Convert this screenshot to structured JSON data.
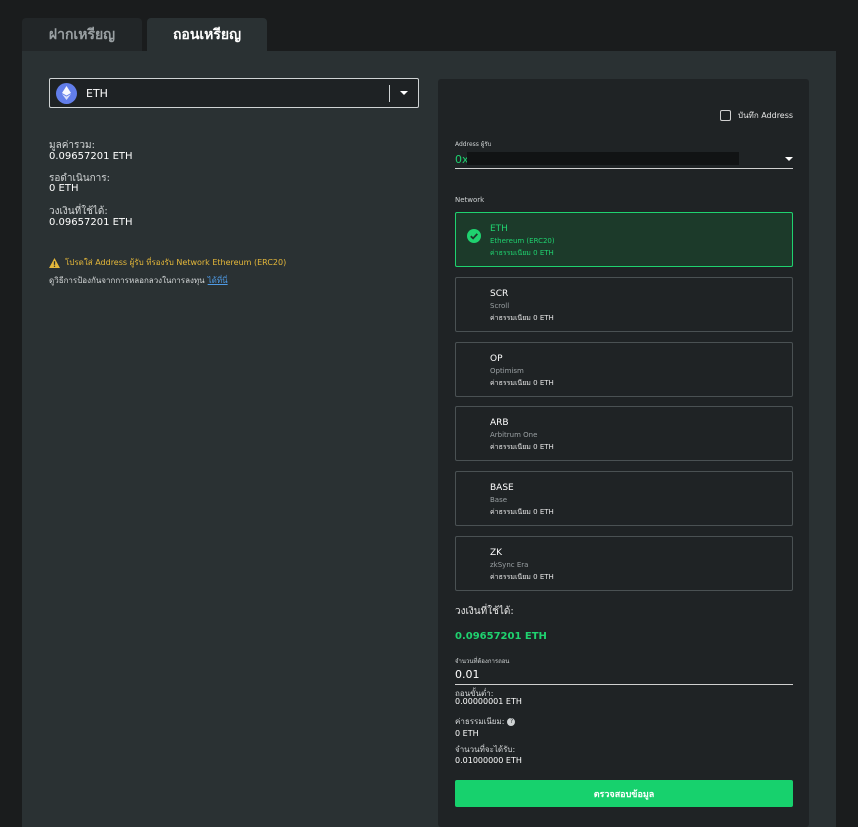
{
  "tabs": {
    "deposit": "ฝากเหรียญ",
    "withdraw": "ถอนเหรียญ"
  },
  "coin_select": {
    "value": "ETH",
    "icon": "ethereum-icon"
  },
  "balance": {
    "total_label": "มูลค่ารวม:",
    "total_value": "0.09657201 ETH",
    "pending_label": "รอดำเนินการ:",
    "pending_value": "0 ETH",
    "available_label": "วงเงินที่ใช้ได้:",
    "available_value": "0.09657201 ETH"
  },
  "warning": {
    "text": "โปรดใส่ Address ผู้รับ ที่รองรับ Network Ethereum (ERC20)",
    "icon": "warning-icon"
  },
  "hint": {
    "text": "ดูวิธีการป้องกันจากการหลอกลวงในการลงทุน",
    "link": "ได้ที่นี่"
  },
  "save_address": {
    "label": "บันทึก Address"
  },
  "address": {
    "label": "Address ผู้รับ",
    "value": "0x"
  },
  "network": {
    "label": "Network",
    "items": [
      {
        "code": "ETH",
        "name": "Ethereum (ERC20)",
        "fee": "ค่าธรรมเนียม 0 ETH"
      },
      {
        "code": "SCR",
        "name": "Scroll",
        "fee": "ค่าธรรมเนียม 0 ETH"
      },
      {
        "code": "OP",
        "name": "Optimism",
        "fee": "ค่าธรรมเนียม 0 ETH"
      },
      {
        "code": "ARB",
        "name": "Arbitrum One",
        "fee": "ค่าธรรมเนียม 0 ETH"
      },
      {
        "code": "BASE",
        "name": "Base",
        "fee": "ค่าธรรมเนียม 0 ETH"
      },
      {
        "code": "ZK",
        "name": "zkSync Era",
        "fee": "ค่าธรรมเนียม 0 ETH"
      }
    ],
    "selected": "ETH"
  },
  "withdraw": {
    "available_label": "วงเงินที่ใช้ได้:",
    "available_value": "0.09657201 ETH",
    "amount_label": "จำนวนที่ต้องการถอน",
    "amount_value": "0.01",
    "min_label": "ถอนขั้นต่ำ:",
    "min_value": "0.00000001 ETH",
    "fee_label": "ค่าธรรมเนียม:",
    "fee_value": "0 ETH",
    "receive_label": "จำนวนที่จะได้รับ:",
    "receive_value": "0.01000000 ETH",
    "submit_label": "ตรวจสอบข้อมูล"
  },
  "colors": {
    "accent": "#17d16d",
    "warning": "#e5b83a",
    "link": "#4f9be6",
    "panel": "#2a3133",
    "card": "#1f2325"
  }
}
